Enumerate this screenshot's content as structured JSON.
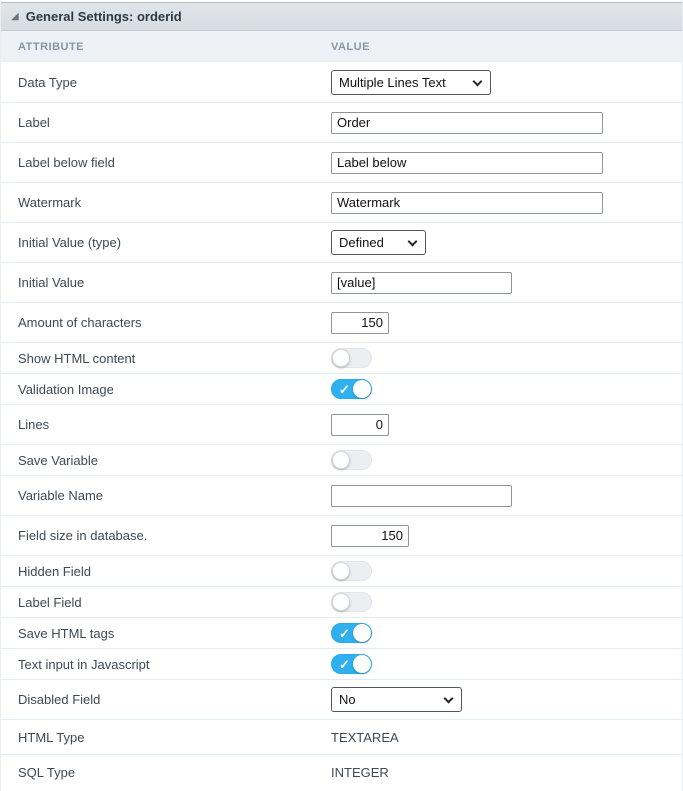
{
  "panel": {
    "title": "General Settings: orderid",
    "collapse_icon_glyph": "◢"
  },
  "columns": {
    "attribute": "ATTRIBUTE",
    "value": "VALUE"
  },
  "colors": {
    "toggle_on_blue": "#2fb1ef",
    "titlebar_bg": "#d9dfe4",
    "colheader_bg": "#edf1f5",
    "row_divider": "#e0ebf5"
  },
  "toggle": {
    "check_glyph": "✓"
  },
  "rows": [
    {
      "name": "data-type",
      "label": "Data Type",
      "type": "select",
      "value": "Multiple Lines Text",
      "size": "sel-lg"
    },
    {
      "name": "label",
      "label": "Label",
      "type": "text",
      "value": "Order",
      "size": "w-lg"
    },
    {
      "name": "label-below-field",
      "label": "Label below field",
      "type": "text",
      "value": "Label below",
      "size": "w-lg"
    },
    {
      "name": "watermark",
      "label": "Watermark",
      "type": "text",
      "value": "Watermark",
      "size": "w-lg"
    },
    {
      "name": "initial-value-type",
      "label": "Initial Value (type)",
      "type": "select",
      "value": "Defined",
      "size": "sel-sm"
    },
    {
      "name": "initial-value",
      "label": "Initial Value",
      "type": "text",
      "value": "[value]",
      "size": "w-md"
    },
    {
      "name": "amount-of-characters",
      "label": "Amount of characters",
      "type": "number",
      "value": "150",
      "size": "w-xs"
    },
    {
      "name": "show-html-content",
      "label": "Show HTML content",
      "type": "toggle",
      "value": false
    },
    {
      "name": "validation-image",
      "label": "Validation Image",
      "type": "toggle",
      "value": true
    },
    {
      "name": "lines",
      "label": "Lines",
      "type": "number",
      "value": "0",
      "size": "w-xs"
    },
    {
      "name": "save-variable",
      "label": "Save Variable",
      "type": "toggle",
      "value": false
    },
    {
      "name": "variable-name",
      "label": "Variable Name",
      "type": "text",
      "value": "",
      "size": "w-md"
    },
    {
      "name": "field-size-in-database",
      "label": "Field size in database.",
      "type": "number",
      "value": "150",
      "size": "w-sm"
    },
    {
      "name": "hidden-field",
      "label": "Hidden Field",
      "type": "toggle",
      "value": false
    },
    {
      "name": "label-field",
      "label": "Label Field",
      "type": "toggle",
      "value": false
    },
    {
      "name": "save-html-tags",
      "label": "Save HTML tags",
      "type": "toggle",
      "value": true
    },
    {
      "name": "text-input-in-javascript",
      "label": "Text input in Javascript",
      "type": "toggle",
      "value": true
    },
    {
      "name": "disabled-field",
      "label": "Disabled Field",
      "type": "select",
      "value": "No",
      "size": "sel-md"
    },
    {
      "name": "html-type",
      "label": "HTML Type",
      "type": "static",
      "value": "TEXTAREA"
    },
    {
      "name": "sql-type",
      "label": "SQL Type",
      "type": "static",
      "value": "INTEGER"
    }
  ]
}
